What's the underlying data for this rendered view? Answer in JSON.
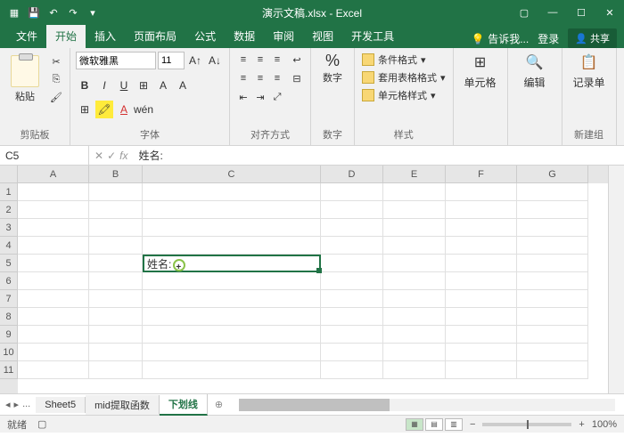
{
  "title": "演示文稿.xlsx - Excel",
  "tabs": {
    "file": "文件",
    "home": "开始",
    "insert": "插入",
    "layout": "页面布局",
    "formula": "公式",
    "data": "数据",
    "review": "审阅",
    "view": "视图",
    "dev": "开发工具",
    "tell": "告诉我...",
    "login": "登录",
    "share": "共享"
  },
  "ribbon": {
    "clipboard": {
      "paste": "粘贴",
      "label": "剪贴板"
    },
    "font": {
      "name": "微软雅黑",
      "size": "11",
      "label": "字体",
      "bold": "B",
      "italic": "I",
      "underline": "U",
      "wen": "wén"
    },
    "align": {
      "label": "对齐方式"
    },
    "number": {
      "btn": "数字",
      "label": "数字",
      "pct": "%"
    },
    "styles": {
      "cond": "条件格式",
      "table": "套用表格格式",
      "cell": "单元格样式",
      "label": "样式"
    },
    "cells": {
      "btn": "单元格"
    },
    "edit": {
      "btn": "编辑"
    },
    "record": {
      "btn": "记录单",
      "label": "新建组"
    }
  },
  "namebox": "C5",
  "formula": "姓名:",
  "cols": [
    "A",
    "B",
    "C",
    "D",
    "E",
    "F",
    "G"
  ],
  "rows": [
    "1",
    "2",
    "3",
    "4",
    "5",
    "6",
    "7",
    "8",
    "9",
    "10",
    "11"
  ],
  "cell_c5": "姓名:",
  "sheets": {
    "s5": "Sheet5",
    "mid": "mid提取函数",
    "und": "下划线"
  },
  "status": {
    "ready": "就绪",
    "rec": "",
    "zoom": "100%"
  }
}
